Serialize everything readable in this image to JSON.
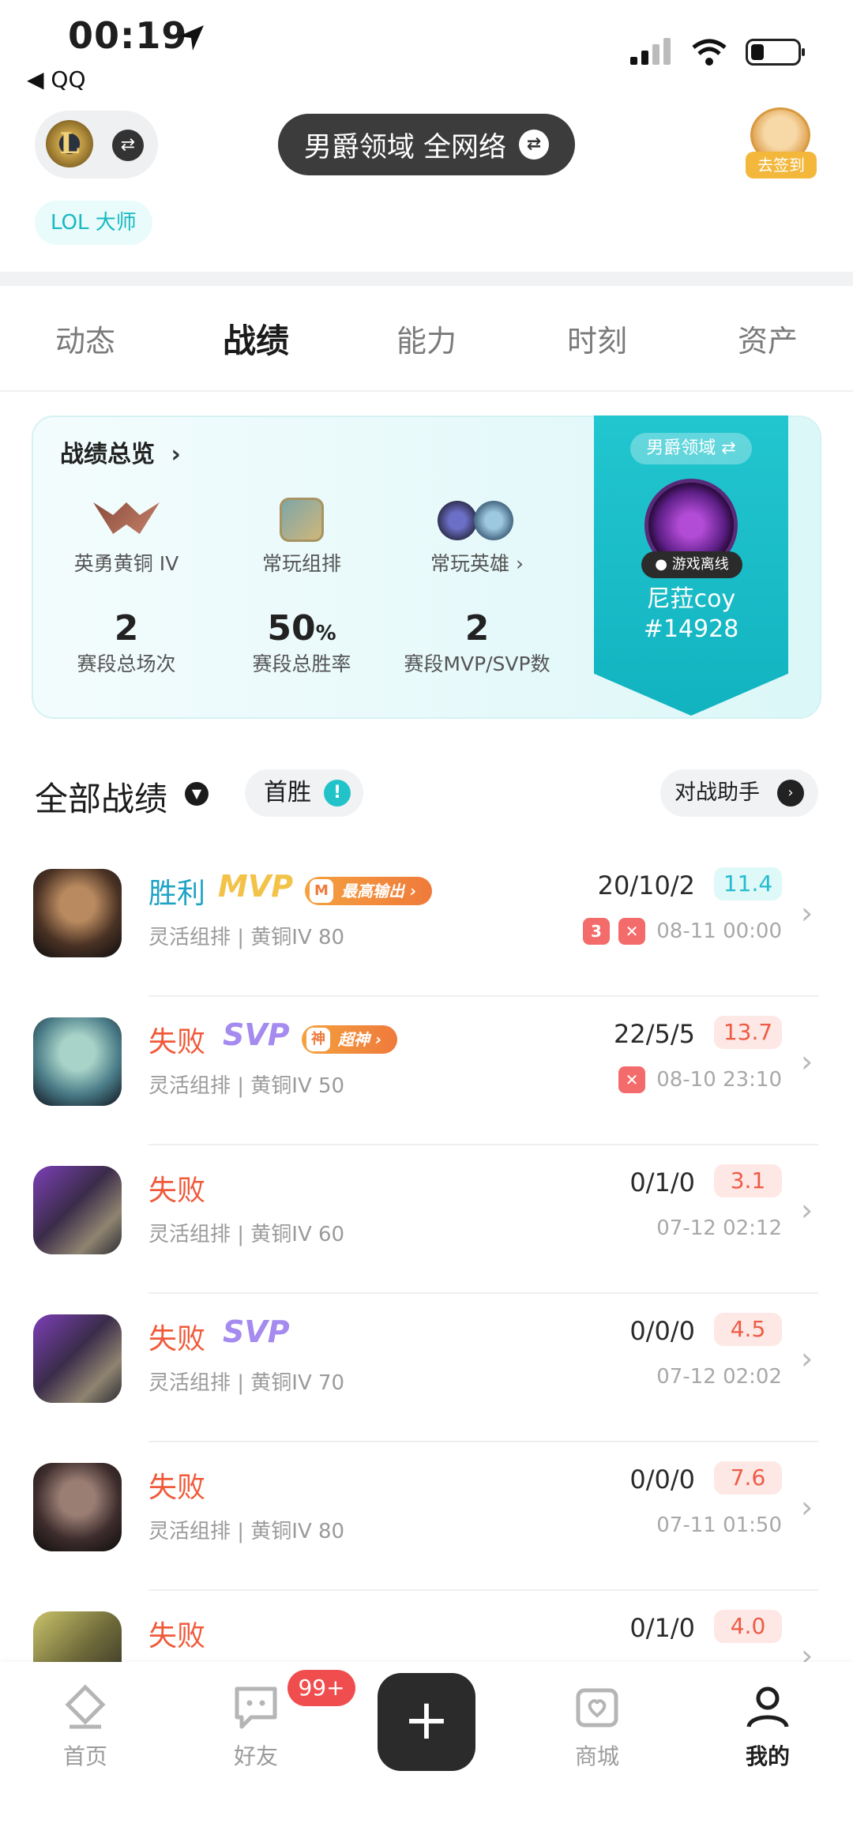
{
  "status_bar": {
    "time": "00:19",
    "back_app": "◀ QQ"
  },
  "header": {
    "game_logo": "L",
    "region_label": "男爵领域 全网络",
    "signin_label": "去签到",
    "tier_tag": "LOL 大师"
  },
  "tabs": [
    {
      "label": "动态"
    },
    {
      "label": "战绩"
    },
    {
      "label": "能力"
    },
    {
      "label": "时刻"
    },
    {
      "label": "资产"
    }
  ],
  "overview": {
    "title": "战绩总览",
    "rank_label": "英勇黄铜 IV",
    "mode_label": "常玩组排",
    "hero_label": "常玩英雄",
    "games_value": "2",
    "games_label": "赛段总场次",
    "winrate_value": "50",
    "winrate_unit": "%",
    "winrate_label": "赛段总胜率",
    "mvp_value": "2",
    "mvp_label": "赛段MVP/SVP数",
    "ribbon_region": "男爵领域",
    "status": "游戏离线",
    "player_name": "尼菈coy",
    "player_tag": "#14928"
  },
  "section": {
    "title": "全部战绩",
    "first_win": "首胜",
    "helper": "对战助手"
  },
  "matches": [
    {
      "result": "胜利",
      "badge": "MVP",
      "tag": "最高输出",
      "tag_icon": "M",
      "mode": "灵活组排 | 黄铜IV 80",
      "kda": "20/10/2",
      "score": "11.4",
      "date": "08-11 00:00"
    },
    {
      "result": "失败",
      "badge": "SVP",
      "tag": "超神",
      "tag_icon": "神",
      "mode": "灵活组排 | 黄铜IV 50",
      "kda": "22/5/5",
      "score": "13.7",
      "date": "08-10 23:10"
    },
    {
      "result": "失败",
      "mode": "灵活组排 | 黄铜IV 60",
      "kda": "0/1/0",
      "score": "3.1",
      "date": "07-12 02:12"
    },
    {
      "result": "失败",
      "badge": "SVP",
      "mode": "灵活组排 | 黄铜IV 70",
      "kda": "0/0/0",
      "score": "4.5",
      "date": "07-12 02:02"
    },
    {
      "result": "失败",
      "mode": "灵活组排 | 黄铜IV 80",
      "kda": "0/0/0",
      "score": "7.6",
      "date": "07-11 01:50"
    },
    {
      "result": "失败",
      "kda": "0/1/0",
      "score": "4.0"
    }
  ],
  "bottom_nav": {
    "home": "首页",
    "friends": "好友",
    "friends_badge": "99+",
    "shop": "商城",
    "me": "我的",
    "plus": "+"
  },
  "colors": {
    "accent_teal": "#18b9c2",
    "win_blue": "#1fa3c4",
    "lose_red": "#f05a3a",
    "mvp_gold": "#f3c248",
    "svp_purple": "#a58aef"
  }
}
